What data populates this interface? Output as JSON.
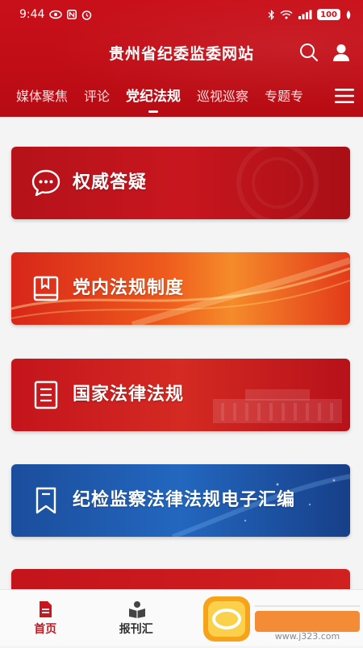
{
  "status_bar": {
    "time": "9:44",
    "battery": "100"
  },
  "header": {
    "title": "贵州省纪委监委网站",
    "tabs": [
      {
        "label": "媒体聚焦",
        "active": false
      },
      {
        "label": "评论",
        "active": false
      },
      {
        "label": "党纪法规",
        "active": true
      },
      {
        "label": "巡视巡察",
        "active": false
      },
      {
        "label": "专题专",
        "active": false
      }
    ]
  },
  "cards": [
    {
      "label": "权威答疑",
      "icon": "chat-bubble-icon"
    },
    {
      "label": "党内法规制度",
      "icon": "book-icon"
    },
    {
      "label": "国家法律法规",
      "icon": "document-icon"
    },
    {
      "label": "纪检监察法律法规电子汇编",
      "icon": "bookmark-icon"
    }
  ],
  "bottom_nav": [
    {
      "label": "首页",
      "icon": "home-doc-icon",
      "active": true
    },
    {
      "label": "报刊汇",
      "icon": "reader-icon",
      "active": false
    },
    {
      "label": "",
      "icon": "nav-icon",
      "active": false
    },
    {
      "label": "",
      "icon": "nav-icon",
      "active": false
    }
  ],
  "watermark": {
    "text": "www.j323.com"
  },
  "colors": {
    "brand_red": "#c10d16",
    "blue_card": "#2367bf",
    "active_nav": "#c8161f"
  }
}
